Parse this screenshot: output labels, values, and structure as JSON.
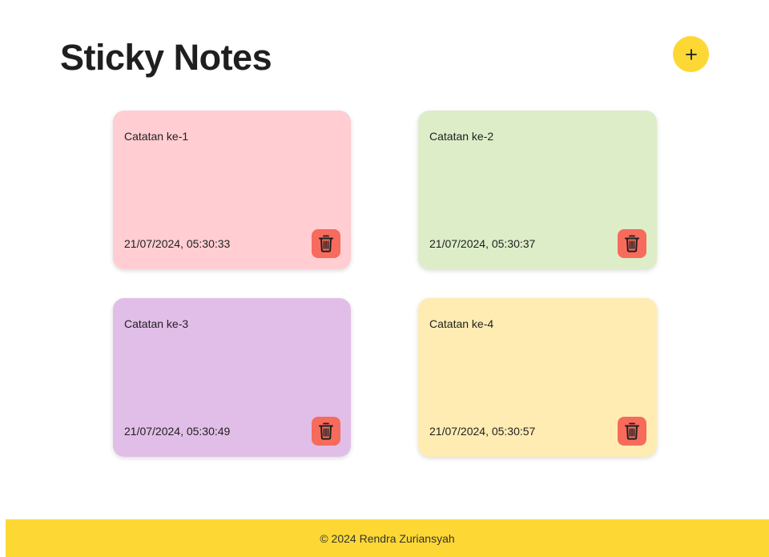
{
  "header": {
    "title": "Sticky Notes",
    "add_button_icon": "plus-icon",
    "add_button_color": "#fdd835"
  },
  "notes": [
    {
      "text": "Catatan ke-1",
      "date": "21/07/2024, 05:30:33",
      "color": "#ffcdd2",
      "delete_icon": "trash-icon"
    },
    {
      "text": "Catatan ke-2",
      "date": "21/07/2024, 05:30:37",
      "color": "#dcedc8",
      "delete_icon": "trash-icon"
    },
    {
      "text": "Catatan ke-3",
      "date": "21/07/2024, 05:30:49",
      "color": "#e1bee7",
      "delete_icon": "trash-icon"
    },
    {
      "text": "Catatan ke-4",
      "date": "21/07/2024, 05:30:57",
      "color": "#ffecb3",
      "delete_icon": "trash-icon"
    }
  ],
  "colors": {
    "delete_button": "#f66b5c",
    "footer": "#fdd835"
  },
  "footer": {
    "text": "© 2024 Rendra Zuriansyah"
  }
}
